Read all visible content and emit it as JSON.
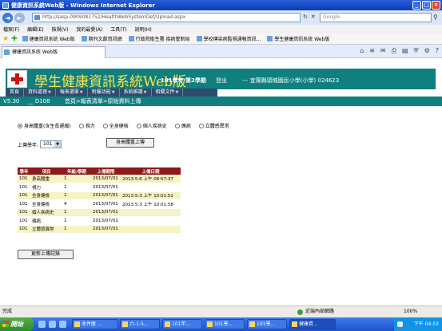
{
  "browser": {
    "window_title": "健康資訊系統Web版 - Windows Internet Explorer",
    "url": "http://sasp-0909081752/HealthWebSystemDef/Upload.aspx",
    "search_placeholder": "Google",
    "menu": [
      "檔案(F)",
      "編輯(E)",
      "檢視(V)",
      "我的最愛(A)",
      "工具(T)",
      "說明(H)"
    ],
    "favorites": [
      "健康資訊系統 Web版",
      "期刊文獻資訊網",
      "行政院衛生署 疾病管制局",
      "學校傳染病監視通報資訊...",
      "學生健康資訊系統 Web版"
    ],
    "tab_title": "健康資訊系統 Web版",
    "status_left": "完成",
    "status_zone": "近端內部網路",
    "zoom": "100%"
  },
  "app": {
    "banner_title": "學生健康資訊系統Web版",
    "semester": "101學年 第2學期",
    "logout": "登出",
    "school": "--- 宜蘭縣頭城國民小學(小學) 024623",
    "main_menu": [
      "首頁",
      "資料處理",
      "報表選單",
      "附屬功能",
      "系統維護",
      "相關文件"
    ],
    "version": "V5.30",
    "user": "__ D108",
    "breadcrumb": "首頁>報表清單>原始資料上傳",
    "upload_options": [
      {
        "label": "身高體重(含生長遲緩)",
        "selected": true
      },
      {
        "label": "視力",
        "selected": false
      },
      {
        "label": "全身健檢",
        "selected": false
      },
      {
        "label": "個人疾病史",
        "selected": false
      },
      {
        "label": "偶病",
        "selected": false
      },
      {
        "label": "立體感異常",
        "selected": false
      }
    ],
    "year_label": "上傳學年:",
    "year_value": "101",
    "upload_button": "身高體重上傳",
    "table": {
      "headers": [
        "學年",
        "項目",
        "年級/學期",
        "上傳期限",
        "上傳日期"
      ],
      "rows": [
        [
          "101",
          "身高體重",
          "1",
          "2013/07/01",
          "2013:5:6 上午 08:57:37"
        ],
        [
          "101",
          "視力",
          "1",
          "2013/07/01",
          ""
        ],
        [
          "101",
          "全身健檢",
          "1",
          "2013/07/01",
          "2013:5:3 上午 10:01:52"
        ],
        [
          "101",
          "全身健檢",
          "4",
          "2013/07/01",
          "2013:5:3 上午 10:01:58"
        ],
        [
          "101",
          "個人疾病史",
          "1",
          "2013/07/01",
          ""
        ],
        [
          "101",
          "偶病",
          "1",
          "2013/07/01",
          ""
        ],
        [
          "101",
          "立體感異常",
          "1",
          "2013/07/01",
          ""
        ]
      ]
    },
    "update_button": "更新上傳記錄"
  },
  "taskbar": {
    "start": "開始",
    "buttons": [
      "收件匣 ...",
      "六-1-5...",
      "101年...",
      "101學...",
      "101學...",
      "健康資..."
    ],
    "clock": "下午 04:53"
  }
}
